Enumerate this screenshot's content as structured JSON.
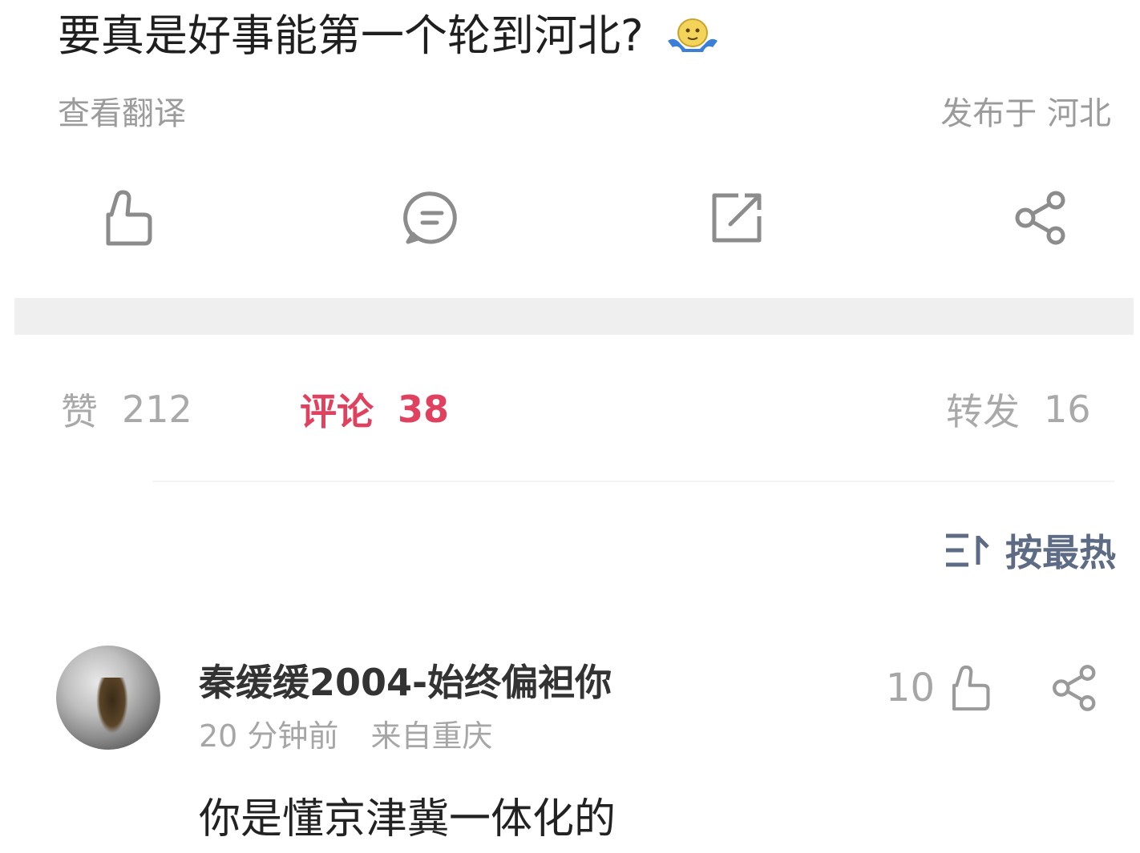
{
  "post": {
    "text": "要真是好事能第一个轮到河北?",
    "emoji": "shrugging-face",
    "translate_label": "查看翻译",
    "published_prefix": "发布于",
    "published_location": "河北"
  },
  "actions": {
    "icons": [
      "thumbs-up-icon",
      "comment-icon",
      "repost-icon",
      "share-icon"
    ]
  },
  "stats": {
    "likes_label": "赞",
    "likes_count": "212",
    "comments_label": "评论",
    "comments_count": "38",
    "reposts_label": "转发",
    "reposts_count": "16",
    "active_color": "#e0415e"
  },
  "sort": {
    "label": "按最热",
    "icon": "sort-icon"
  },
  "comment": {
    "username": "秦缓缓2004-始终偏袒你",
    "time": "20 分钟前",
    "location": "来自重庆",
    "text": "你是懂京津冀一体化的",
    "like_count": "10"
  }
}
